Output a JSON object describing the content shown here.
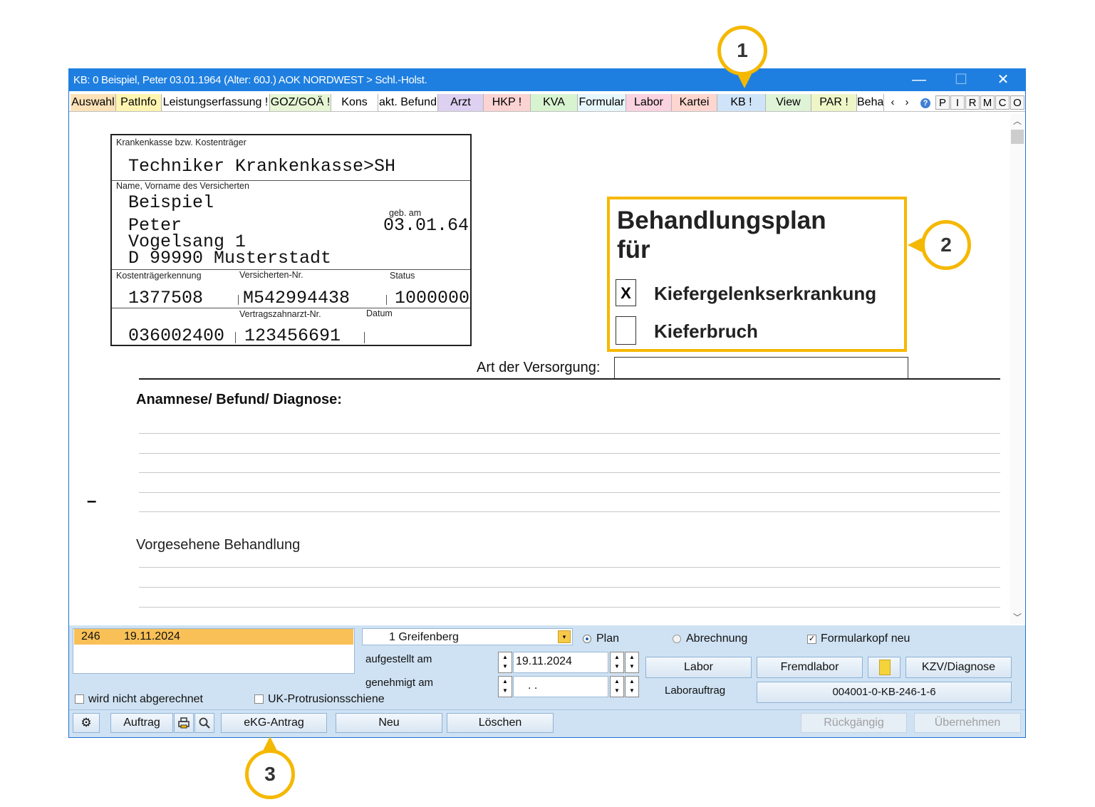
{
  "window": {
    "title": "KB: 0  Beispiel, Peter  03.01.1964 (Alter: 60J.)  AOK NORDWEST > Schl.-Holst."
  },
  "tabs": [
    {
      "label": "Auswahl",
      "color": "#fde2b8"
    },
    {
      "label": "PatInfo",
      "color": "#fff5b0"
    },
    {
      "label": "Leistungserfassung !",
      "color": "#ffffff"
    },
    {
      "label": "GOZ/GOÄ !",
      "color": "#e6f5d4"
    },
    {
      "label": "Kons",
      "color": "#ffffff"
    },
    {
      "label": "akt. Befund",
      "color": "#ffffff"
    },
    {
      "label": "Arzt",
      "color": "#ddd0f0"
    },
    {
      "label": "HKP !",
      "color": "#fbd3d3"
    },
    {
      "label": "KVA",
      "color": "#d8f3d0"
    },
    {
      "label": "Formular",
      "color": "#e6f6fb"
    },
    {
      "label": "Labor",
      "color": "#fad2e0"
    },
    {
      "label": "Kartei",
      "color": "#fcd6cf"
    },
    {
      "label": "KB !",
      "color": "#cfe4f8"
    },
    {
      "label": "View",
      "color": "#dff3d6"
    },
    {
      "label": "PAR !",
      "color": "#eef6c8"
    },
    {
      "label": "Beha",
      "color": "#ffffff"
    }
  ],
  "tab_extras": {
    "left": "‹",
    "right": "›",
    "help": "?",
    "letters": [
      "P",
      "I",
      "R",
      "M",
      "C",
      "O"
    ]
  },
  "form": {
    "kasse_label": "Krankenkasse bzw. Kostenträger",
    "kasse": "Techniker Krankenkasse>SH",
    "name_label": "Name, Vorname des Versicherten",
    "lastname": "Beispiel",
    "firstname": "Peter",
    "geb_label": "geb. am",
    "dob": "03.01.64",
    "street": "Vogelsang 1",
    "city": "D 99990 Musterstadt",
    "kt_label": "Kostenträgerkennung",
    "kt": "1377508",
    "vnr_label": "Versicherten-Nr.",
    "vnr": "M542994438",
    "status_label": "Status",
    "status": "1000000",
    "vza_label": "Vertragszahnarzt-Nr.",
    "datum_label": "Datum",
    "bsnr": "036002400",
    "vza": "123456691"
  },
  "plan": {
    "title1": "Behandlungsplan",
    "title2": "für",
    "opt1_mark": "X",
    "opt1": "Kiefergelenkserkrankung",
    "opt2_mark": "",
    "opt2": "Kieferbruch"
  },
  "versorgung_label": "Art der Versorgung:",
  "anamnese_label": "Anamnese/ Befund/ Diagnose:",
  "side_dash": "–",
  "behandlung_label": "Vorgesehene Behandlung",
  "callouts": {
    "one": "1",
    "two": "2",
    "three": "3"
  },
  "panel": {
    "list_row": {
      "nr": "246",
      "date": "19.11.2024"
    },
    "dentist": "1 Greifenberg",
    "radio_plan": "Plan",
    "radio_abrechnung": "Abrechnung",
    "formularkopf": "Formularkopf neu",
    "aufgestellt_label": "aufgestellt am",
    "aufgestellt": "19.11.2024",
    "genehmigt_label": "genehmigt am",
    "genehmigt": " .  .",
    "btn_labor": "Labor",
    "btn_fremdlabor": "Fremdlabor",
    "btn_kzv": "KZV/Diagnose",
    "laborauftrag_label": "Laborauftrag",
    "laborauftrag": "004001-0-KB-246-1-6",
    "chk_nicht": "wird nicht abgerechnet",
    "chk_uk": "UK-Protrusionsschiene",
    "btn_auftrag": "Auftrag",
    "btn_ekg": "eKG-Antrag",
    "btn_neu": "Neu",
    "btn_loeschen": "Löschen",
    "btn_rueck": "Rückgängig",
    "btn_uebernehmen": "Übernehmen"
  }
}
